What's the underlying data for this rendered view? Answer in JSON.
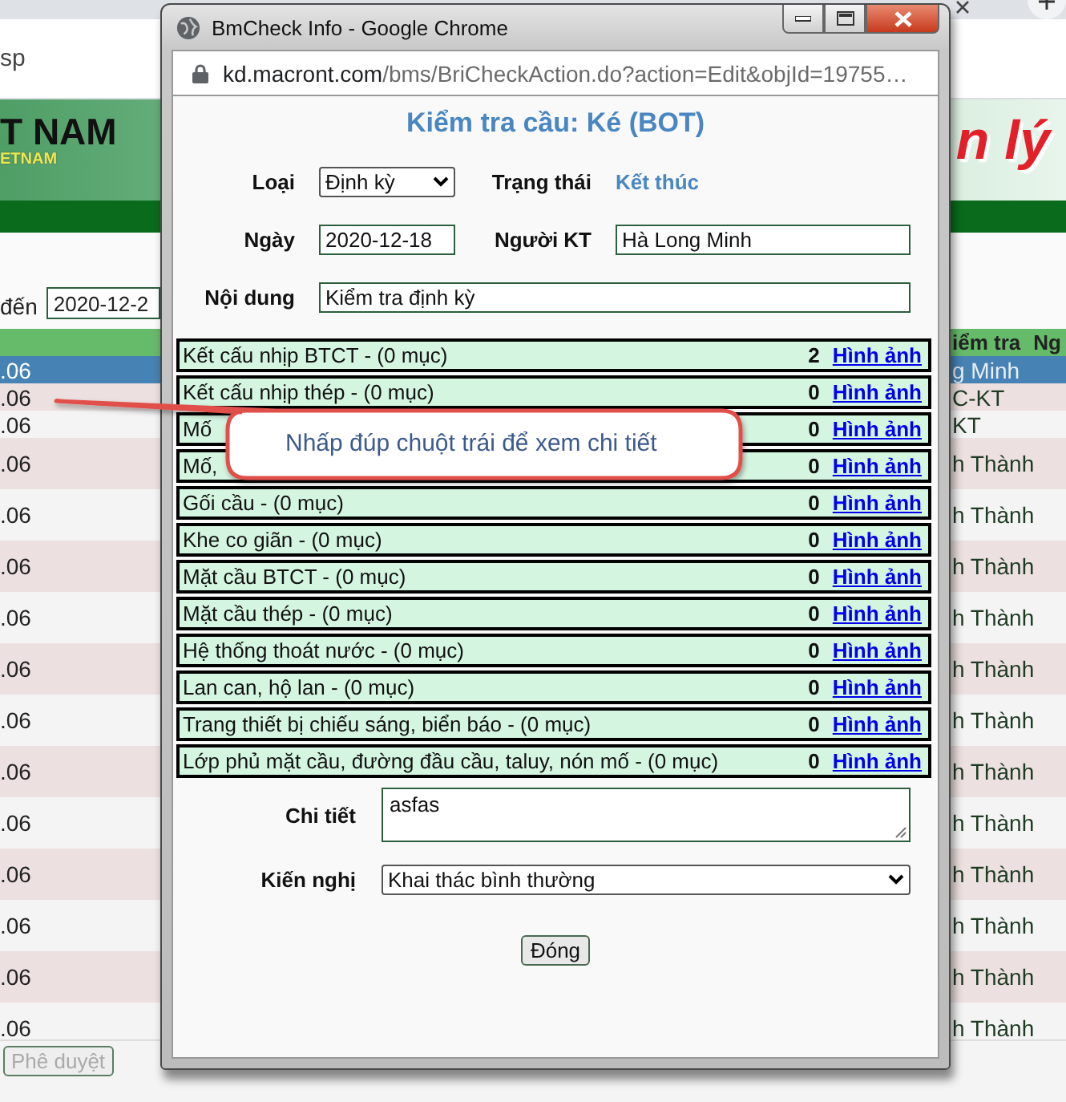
{
  "background": {
    "address_fragment": "sp",
    "banner": {
      "logo_line1": "T NAM",
      "logo_line2": "ETNAM",
      "title_fragment": "n lý"
    },
    "filter": {
      "label": "đến",
      "date_value": "2020-12-2"
    },
    "table": {
      "header": [
        "iểm tra",
        "Ng"
      ],
      "rows": [
        {
          "column_1": ".06",
          "column_2": "g Minh",
          "selected": true
        },
        {
          "column_1": ".06",
          "column_2": "C-KT",
          "selected": false
        },
        {
          "column_1": ".06",
          "column_2": "KT",
          "selected": false
        },
        {
          "column_1": ".06",
          "column_2": "h Thành",
          "selected": false
        },
        {
          "column_1": ".06",
          "column_2": "h Thành",
          "selected": false
        },
        {
          "column_1": ".06",
          "column_2": "h Thành",
          "selected": false
        },
        {
          "column_1": ".06",
          "column_2": "h Thành",
          "selected": false
        },
        {
          "column_1": ".06",
          "column_2": "h Thành",
          "selected": false
        },
        {
          "column_1": ".06",
          "column_2": "h Thành",
          "selected": false
        },
        {
          "column_1": ".06",
          "column_2": "h Thành",
          "selected": false
        },
        {
          "column_1": ".06",
          "column_2": "h Thành",
          "selected": false
        },
        {
          "column_1": ".06",
          "column_2": "h Thành",
          "selected": false
        },
        {
          "column_1": ".06",
          "column_2": "h Thành",
          "selected": false
        },
        {
          "column_1": ".06",
          "column_2": "h Thành",
          "selected": false
        },
        {
          "column_1": ".06",
          "column_2": "h Thành",
          "selected": false
        }
      ]
    },
    "approve_button": {
      "label": "Phê duyệt",
      "disabled": true
    }
  },
  "popup": {
    "title": "BmCheck Info - Google Chrome",
    "url": {
      "host": "kd.macront.com",
      "path": "/bms/BriCheckAction.do?action=Edit&objId=19755…"
    },
    "heading": "Kiểm tra cầu: Ké (BOT)",
    "fields": {
      "type": {
        "label": "Loại",
        "value": "Định kỳ"
      },
      "status": {
        "label": "Trạng thái",
        "value": "Kết thúc"
      },
      "date": {
        "label": "Ngày",
        "value": "2020-12-18"
      },
      "inspector": {
        "label": "Người KT",
        "value": "Hà Long Minh"
      },
      "content": {
        "label": "Nội dung",
        "value": "Kiểm tra định kỳ"
      }
    },
    "sections": [
      {
        "label": "Kết cấu nhịp BTCT - (0 mục)",
        "count": "2",
        "link": "Hình ảnh"
      },
      {
        "label": "Kết cấu nhịp thép - (0 mục)",
        "count": "0",
        "link": "Hình ảnh"
      },
      {
        "label": "Mố",
        "count": "0",
        "link": "Hình ảnh"
      },
      {
        "label": "Mố,",
        "count": "0",
        "link": "Hình ảnh"
      },
      {
        "label": "Gối cầu - (0 mục)",
        "count": "0",
        "link": "Hình ảnh"
      },
      {
        "label": "Khe co giãn - (0 mục)",
        "count": "0",
        "link": "Hình ảnh"
      },
      {
        "label": "Mặt cầu BTCT - (0 mục)",
        "count": "0",
        "link": "Hình ảnh"
      },
      {
        "label": "Mặt cầu thép - (0 mục)",
        "count": "0",
        "link": "Hình ảnh"
      },
      {
        "label": "Hệ thống thoát nước - (0 mục)",
        "count": "0",
        "link": "Hình ảnh"
      },
      {
        "label": "Lan can, hộ lan - (0 mục)",
        "count": "0",
        "link": "Hình ảnh"
      },
      {
        "label": "Trang thiết bị chiếu sáng, biển báo - (0 mục)",
        "count": "0",
        "link": "Hình ảnh"
      },
      {
        "label": "Lớp phủ mặt cầu, đường đầu cầu, taluy, nón mố - (0 mục)",
        "count": "0",
        "link": "Hình ảnh"
      }
    ],
    "detail": {
      "label": "Chi tiết",
      "value": "asfas"
    },
    "recommendation": {
      "label": "Kiến nghị",
      "value": "Khai thác bình thường"
    },
    "close_button": "Đóng"
  },
  "callout": {
    "text": "Nhấp đúp chuột trái để xem chi tiết"
  }
}
